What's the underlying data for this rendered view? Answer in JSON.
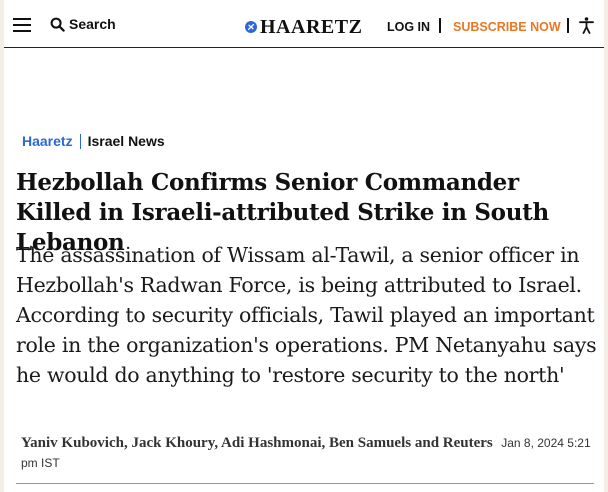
{
  "header": {
    "search_label": "Search",
    "logo_text": "HAARETZ",
    "login_label": "LOG IN",
    "subscribe_label": "SUBSCRIBE NOW",
    "colors": {
      "brand_blue": "#2b67d6",
      "subscribe_orange": "#e87824"
    },
    "icons": [
      "menu-icon",
      "search-icon",
      "logo-mark-icon",
      "accessibility-icon"
    ]
  },
  "breadcrumb": {
    "home": "Haaretz",
    "section": "Israel News"
  },
  "article": {
    "headline": "Hezbollah Confirms Senior Commander Killed in Israeli-attributed Strike in South Lebanon",
    "subheading": "The assassination of Wissam al-Tawil, a senior officer in Hezbollah's Radwan Force, is being attributed to Israel. According to security officials, Tawil played an important role in the organization's operations. PM Netanyahu says he would do anything to 'restore security to the north'",
    "authors": "Yaniv Kubovich, Jack Khoury, Adi Hashmonai, Ben Samuels and Reuters",
    "date": "Jan 8, 2024 5:21 pm IST"
  }
}
